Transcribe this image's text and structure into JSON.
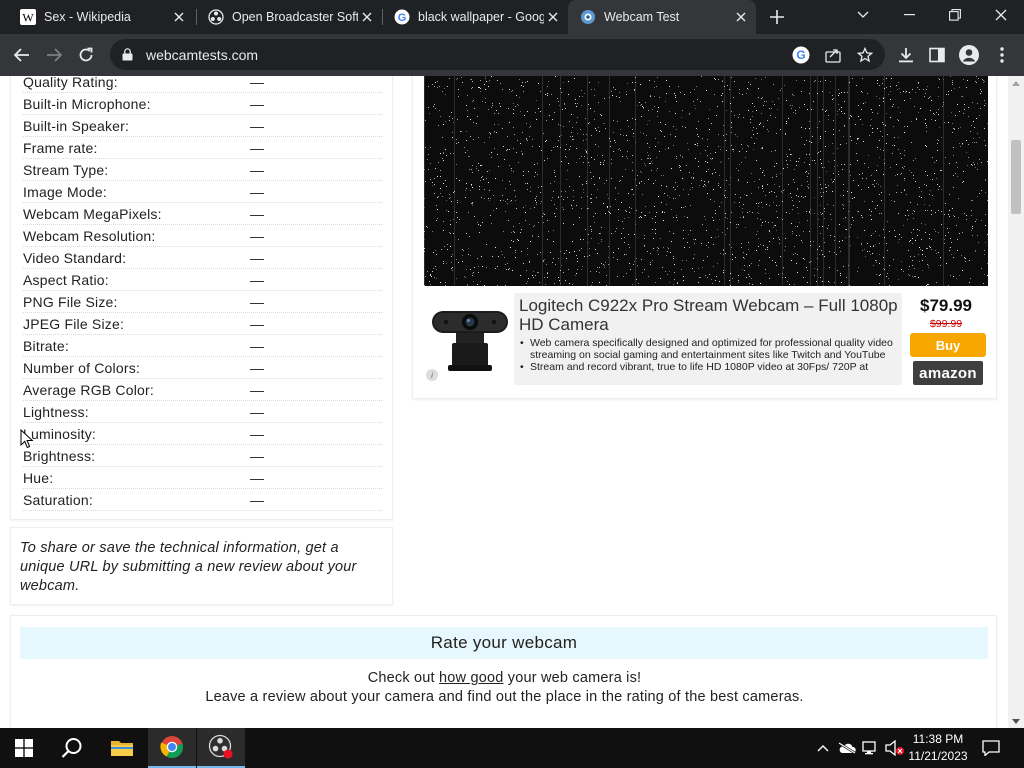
{
  "browser": {
    "tabs": [
      {
        "title": "Sex - Wikipedia",
        "icon": "wikipedia-icon",
        "active": false
      },
      {
        "title": "Open Broadcaster Software",
        "icon": "obs-icon",
        "active": false
      },
      {
        "title": "black wallpaper - Google",
        "icon": "google-icon",
        "active": false
      },
      {
        "title": "Webcam Test",
        "icon": "webcamtests-icon",
        "active": true
      }
    ],
    "url": "webcamtests.com",
    "accent": "#35363a",
    "tabstrip_color": "#202124"
  },
  "tech_info": {
    "rows": [
      {
        "label": "Quality Rating:",
        "value": "—"
      },
      {
        "label": "Built-in Microphone:",
        "value": "—"
      },
      {
        "label": "Built-in Speaker:",
        "value": "—"
      },
      {
        "label": "Frame rate:",
        "value": "—"
      },
      {
        "label": "Stream Type:",
        "value": "—"
      },
      {
        "label": "Image Mode:",
        "value": "—"
      },
      {
        "label": "Webcam MegaPixels:",
        "value": "—"
      },
      {
        "label": "Webcam Resolution:",
        "value": "—"
      },
      {
        "label": "Video Standard:",
        "value": "—"
      },
      {
        "label": "Aspect Ratio:",
        "value": "—"
      },
      {
        "label": "PNG File Size:",
        "value": "—"
      },
      {
        "label": "JPEG File Size:",
        "value": "—"
      },
      {
        "label": "Bitrate:",
        "value": "—"
      },
      {
        "label": "Number of Colors:",
        "value": "—"
      },
      {
        "label": "Average RGB Color:",
        "value": "—"
      },
      {
        "label": "Lightness:",
        "value": "—"
      },
      {
        "label": "Luminosity:",
        "value": "—"
      },
      {
        "label": "Brightness:",
        "value": "—"
      },
      {
        "label": "Hue:",
        "value": "—"
      },
      {
        "label": "Saturation:",
        "value": "—"
      }
    ]
  },
  "share": {
    "text": "To share or save the technical information, get a unique URL by submitting a new review about your webcam."
  },
  "ad": {
    "title": "Logitech C922x Pro Stream Webcam – Full 1080p HD Camera",
    "bullets": [
      "Web camera specifically designed and optimized for professional quality video streaming on social gaming and entertainment sites like Twitch and YouTube",
      "Stream and record vibrant, true to life HD 1080P video at 30Fps/ 720P at"
    ],
    "price": "$79.99",
    "old_price": "$99.99",
    "buy_label": "Buy",
    "store_label": "amazon",
    "info_label": "i",
    "buy_color": "#f7a600"
  },
  "rate": {
    "heading": "Rate your webcam",
    "line1_before": "Check out ",
    "line1_link": "how good",
    "line1_after": " your web camera is!",
    "line2": "Leave a review about your camera and find out the place in the rating of the best cameras.",
    "heading_bg": "#e6f7fd"
  },
  "taskbar": {
    "apps": [
      "windows-start-icon",
      "search-icon",
      "file-explorer-icon",
      "chrome-icon",
      "obs-icon"
    ],
    "time": "11:38 PM",
    "date": "11/21/2023"
  }
}
